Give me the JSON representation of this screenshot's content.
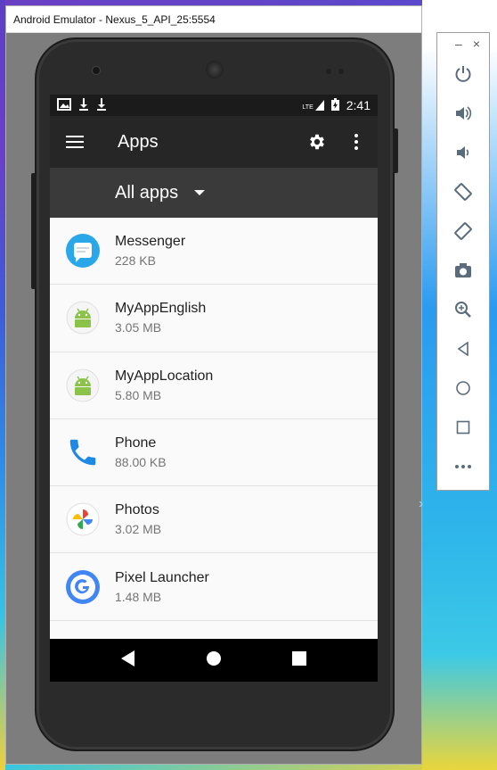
{
  "window": {
    "title": "Android Emulator - Nexus_5_API_25:5554"
  },
  "statusbar": {
    "time": "2:41",
    "net_label": "LTE"
  },
  "appbar": {
    "title": "Apps"
  },
  "filter": {
    "label": "All apps"
  },
  "apps": [
    {
      "name": "Messenger",
      "size": "228 KB",
      "icon": "messenger-icon"
    },
    {
      "name": "MyAppEnglish",
      "size": "3.05 MB",
      "icon": "android-icon"
    },
    {
      "name": "MyAppLocation",
      "size": "5.80 MB",
      "icon": "android-icon"
    },
    {
      "name": "Phone",
      "size": "88.00 KB",
      "icon": "phone-icon"
    },
    {
      "name": "Photos",
      "size": "3.02 MB",
      "icon": "photos-icon"
    },
    {
      "name": "Pixel Launcher",
      "size": "1.48 MB",
      "icon": "google-icon"
    }
  ],
  "toolbar": {
    "minimize": "–",
    "close": "×",
    "buttons": [
      "power-icon",
      "volume-up-icon",
      "volume-down-icon",
      "rotate-left-icon",
      "rotate-right-icon",
      "camera-icon",
      "zoom-icon",
      "back-icon",
      "home-icon",
      "overview-icon",
      "more-icon"
    ]
  },
  "colors": {
    "appbar": "#262626",
    "filterbar": "#3a3a3a",
    "statusbar": "#1b1b1b",
    "toolbar_icon": "#5a6b7c"
  }
}
